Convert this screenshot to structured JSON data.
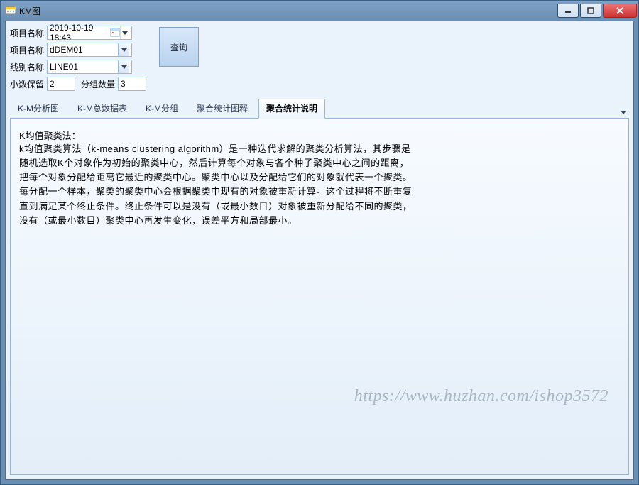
{
  "window": {
    "title": "KM图"
  },
  "form": {
    "row1_label": "项目名称",
    "row1_value": "2019-10-19 18:43",
    "row2_label": "项目名称",
    "row2_value": "dDEM01",
    "row3_label": "线别名称",
    "row3_value": "LINE01",
    "row4a_label": "小数保留",
    "row4a_value": "2",
    "row4b_label": "分组数量",
    "row4b_value": "3",
    "query_button": "查询"
  },
  "tabs": {
    "t1": "K-M分析图",
    "t2": "K-M总数据表",
    "t3": "K-M分组",
    "t4": "聚合统计图释",
    "t5": "聚合统计说明"
  },
  "content": {
    "title": "K均值聚类法：",
    "body": "k均值聚类算法（k-means clustering algorithm）是一种迭代求解的聚类分析算法，其步骤是随机选取K个对象作为初始的聚类中心，然后计算每个对象与各个种子聚类中心之间的距离，把每个对象分配给距离它最近的聚类中心。聚类中心以及分配给它们的对象就代表一个聚类。每分配一个样本，聚类的聚类中心会根据聚类中现有的对象被重新计算。这个过程将不断重复直到满足某个终止条件。终止条件可以是没有（或最小数目）对象被重新分配给不同的聚类，没有（或最小数目）聚类中心再发生变化，误差平方和局部最小。"
  },
  "watermark": "https://www.huzhan.com/ishop3572"
}
